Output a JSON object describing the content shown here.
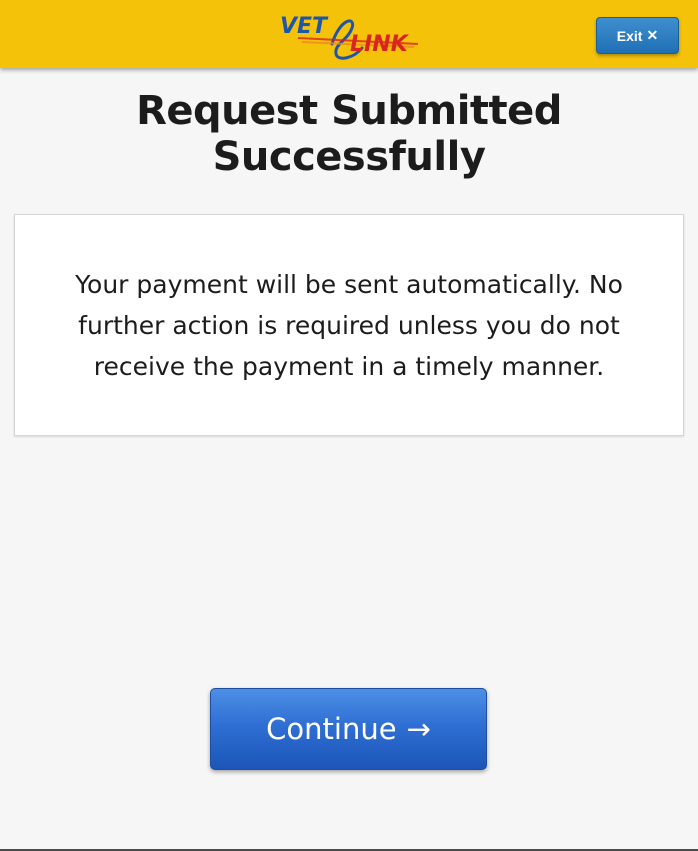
{
  "header": {
    "logo": {
      "part1": "VET",
      "part2": "LINK",
      "icon": "vetlink-logo-icon"
    },
    "exit_label": "Exit",
    "exit_icon": "close-icon",
    "exit_glyph": "✕"
  },
  "main": {
    "title": "Request Submitted Successfully",
    "message": "Your payment will be sent automatically. No further action is required unless you do not receive the payment in a timely manner."
  },
  "footer": {
    "continue_label": "Continue",
    "continue_icon": "arrow-right-icon",
    "continue_glyph": "→"
  },
  "colors": {
    "header_bg": "#f5c20a",
    "logo_blue": "#1f57a8",
    "logo_red": "#d9251d",
    "exit_button": "#2a7cc0",
    "continue_button": "#2f6fd4",
    "page_bg": "#f6f6f6"
  }
}
